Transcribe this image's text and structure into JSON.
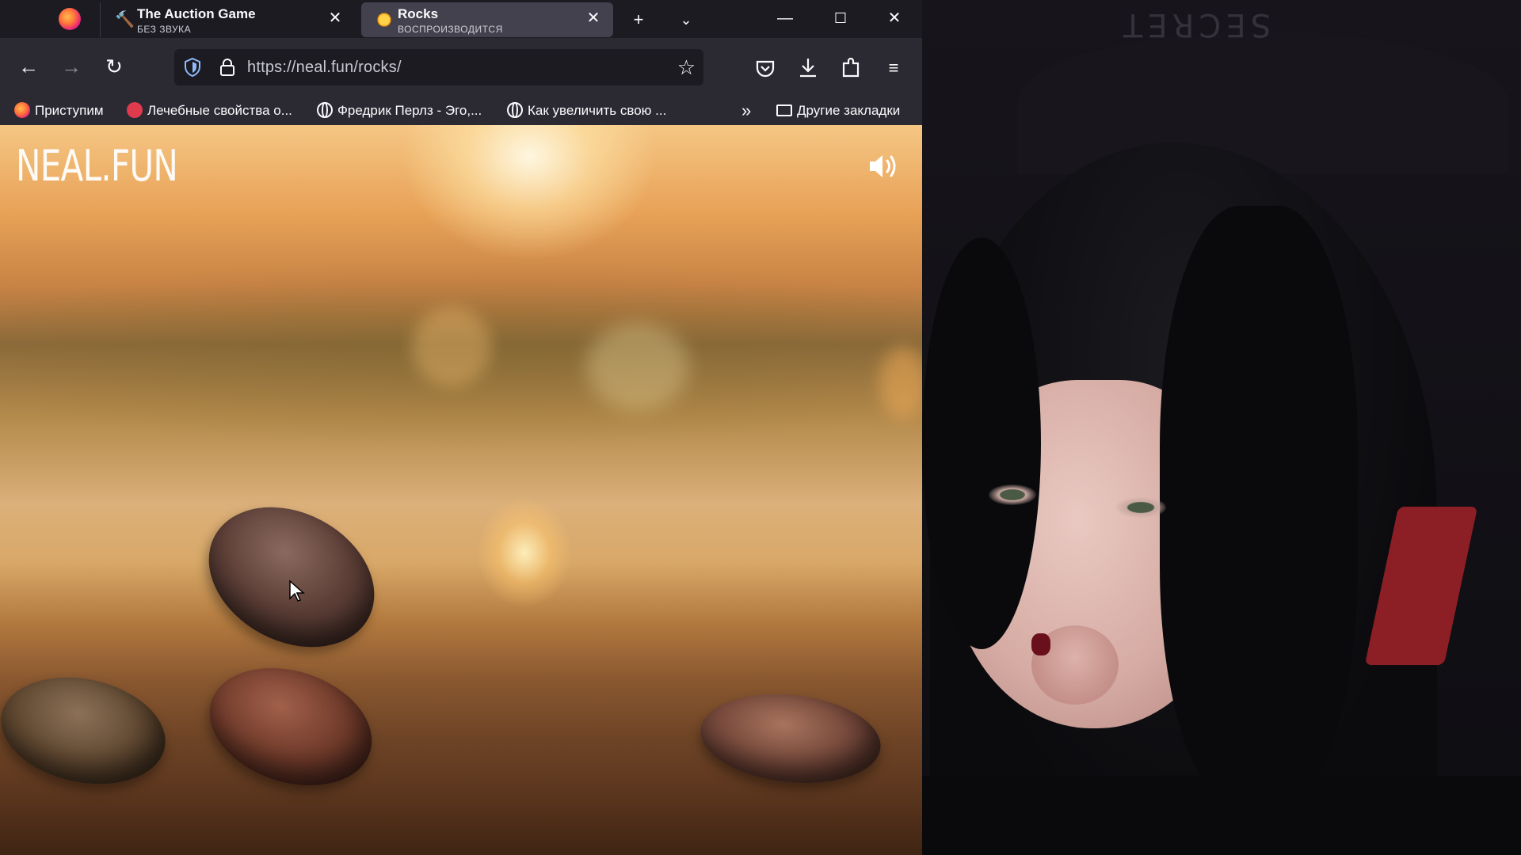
{
  "browser": {
    "tabs": [
      {
        "title": "The Auction Game",
        "subtitle": "БЕЗ ЗВУКА",
        "active": false,
        "icon": "gavel-icon"
      },
      {
        "title": "Rocks",
        "subtitle": "ВОСПРОИЗВОДИТСЯ",
        "active": true,
        "icon": "sun-icon"
      }
    ],
    "url": "https://neal.fun/rocks/",
    "bookmarks": [
      {
        "label": "Приступим",
        "icon": "firefox-icon"
      },
      {
        "label": "Лечебные свойства о...",
        "icon": "red-flower-icon"
      },
      {
        "label": "Фредрик Перлз - Эго,...",
        "icon": "globe-icon"
      },
      {
        "label": "Как увеличить свою ...",
        "icon": "globe-icon"
      }
    ],
    "other_bookmarks": "Другие закладки"
  },
  "page": {
    "logo": "NEAL.FUN"
  },
  "webcam": {
    "chair_brand": "SECRET"
  },
  "colors": {
    "tabstrip": "#1c1b22",
    "toolbar": "#2b2a33",
    "active_tab": "#42414d"
  }
}
